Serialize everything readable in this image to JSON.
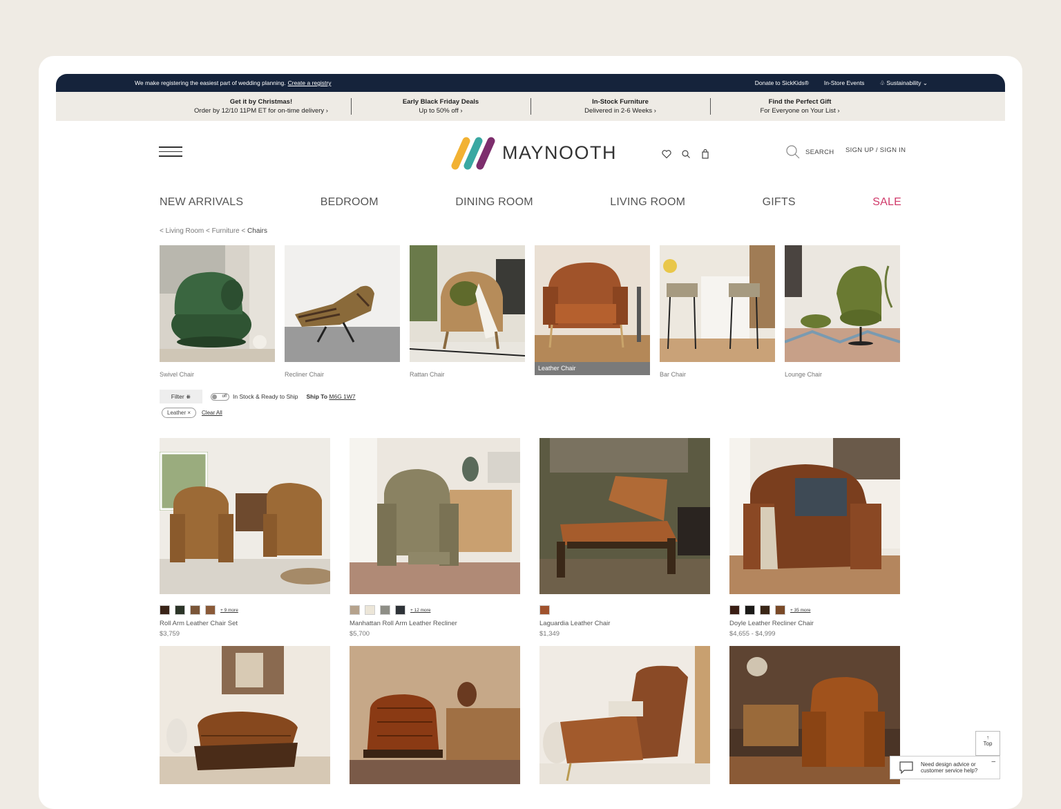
{
  "topbar": {
    "message": "We make registering the easiest part of wedding planning.",
    "registry_link": "Create a registry",
    "links": [
      "Donate to SickKids®",
      "In-Store Events",
      "Sustainability"
    ]
  },
  "promos": [
    {
      "title": "Get it by Christmas!",
      "sub": "Order by 12/10 11PM ET for on-time delivery ›"
    },
    {
      "title": "Early Black Friday Deals",
      "sub": "Up to 50% off ›"
    },
    {
      "title": "In-Stock Furniture",
      "sub": "Delivered in 2-6 Weeks ›"
    },
    {
      "title": "Find the Perfect Gift",
      "sub": "For Everyone on Your List ›"
    }
  ],
  "brand": "MAYNOOTH",
  "header": {
    "search_label": "SEARCH",
    "signin_label": "SIGN UP / SIGN IN"
  },
  "nav": [
    "NEW ARRIVALS",
    "BEDROOM",
    "DINING ROOM",
    "LIVING ROOM",
    "GIFTS",
    "SALE"
  ],
  "breadcrumb": {
    "items": [
      "Living Room",
      "Furniture"
    ],
    "current": "Chairs"
  },
  "categories": [
    {
      "label": "Swivel Chair"
    },
    {
      "label": "Recliner Chair"
    },
    {
      "label": "Rattan Chair"
    },
    {
      "label": "Leather  Chair"
    },
    {
      "label": "Bar Chair"
    },
    {
      "label": "Lounge Chair"
    }
  ],
  "filters": {
    "filter_label": "Filter",
    "toggle_state": "off",
    "toggle_label": "In Stock & Ready to Ship",
    "ship_to_label": "Ship To",
    "ship_to_value": "M6G 1W7",
    "chip": "Leather ×",
    "clear_all": "Clear All"
  },
  "products": [
    {
      "name": "Roll Arm Leather Chair Set",
      "price": "$3,759",
      "more": "+ 9 more",
      "swatches": [
        "#3a2418",
        "#2c3528",
        "#7a5638",
        "#8a5a38"
      ]
    },
    {
      "name": "Manhattan Roll Arm Leather Recliner",
      "price": "$5,700",
      "more": "+ 12 more",
      "swatches": [
        "#b5a28c",
        "#ece6d8",
        "#8e8e86",
        "#2e3338"
      ]
    },
    {
      "name": "Laguardia Leather Chair",
      "price": "$1,349",
      "more": "",
      "swatches": [
        "#a0522d"
      ]
    },
    {
      "name": "Doyle Leather Recliner Chair",
      "price": "$4,655 - $4,999",
      "more": "+ 35 more",
      "swatches": [
        "#3a1e14",
        "#1c1a18",
        "#3a2616",
        "#7a4a28"
      ]
    }
  ],
  "floating": {
    "top_label": "Top",
    "help_text_1": "Need design advice or",
    "help_text_2": "customer service help?"
  },
  "colors": {
    "topbar": "#15233b",
    "sale": "#d03a6a",
    "promo_bg": "#eeebe5"
  }
}
